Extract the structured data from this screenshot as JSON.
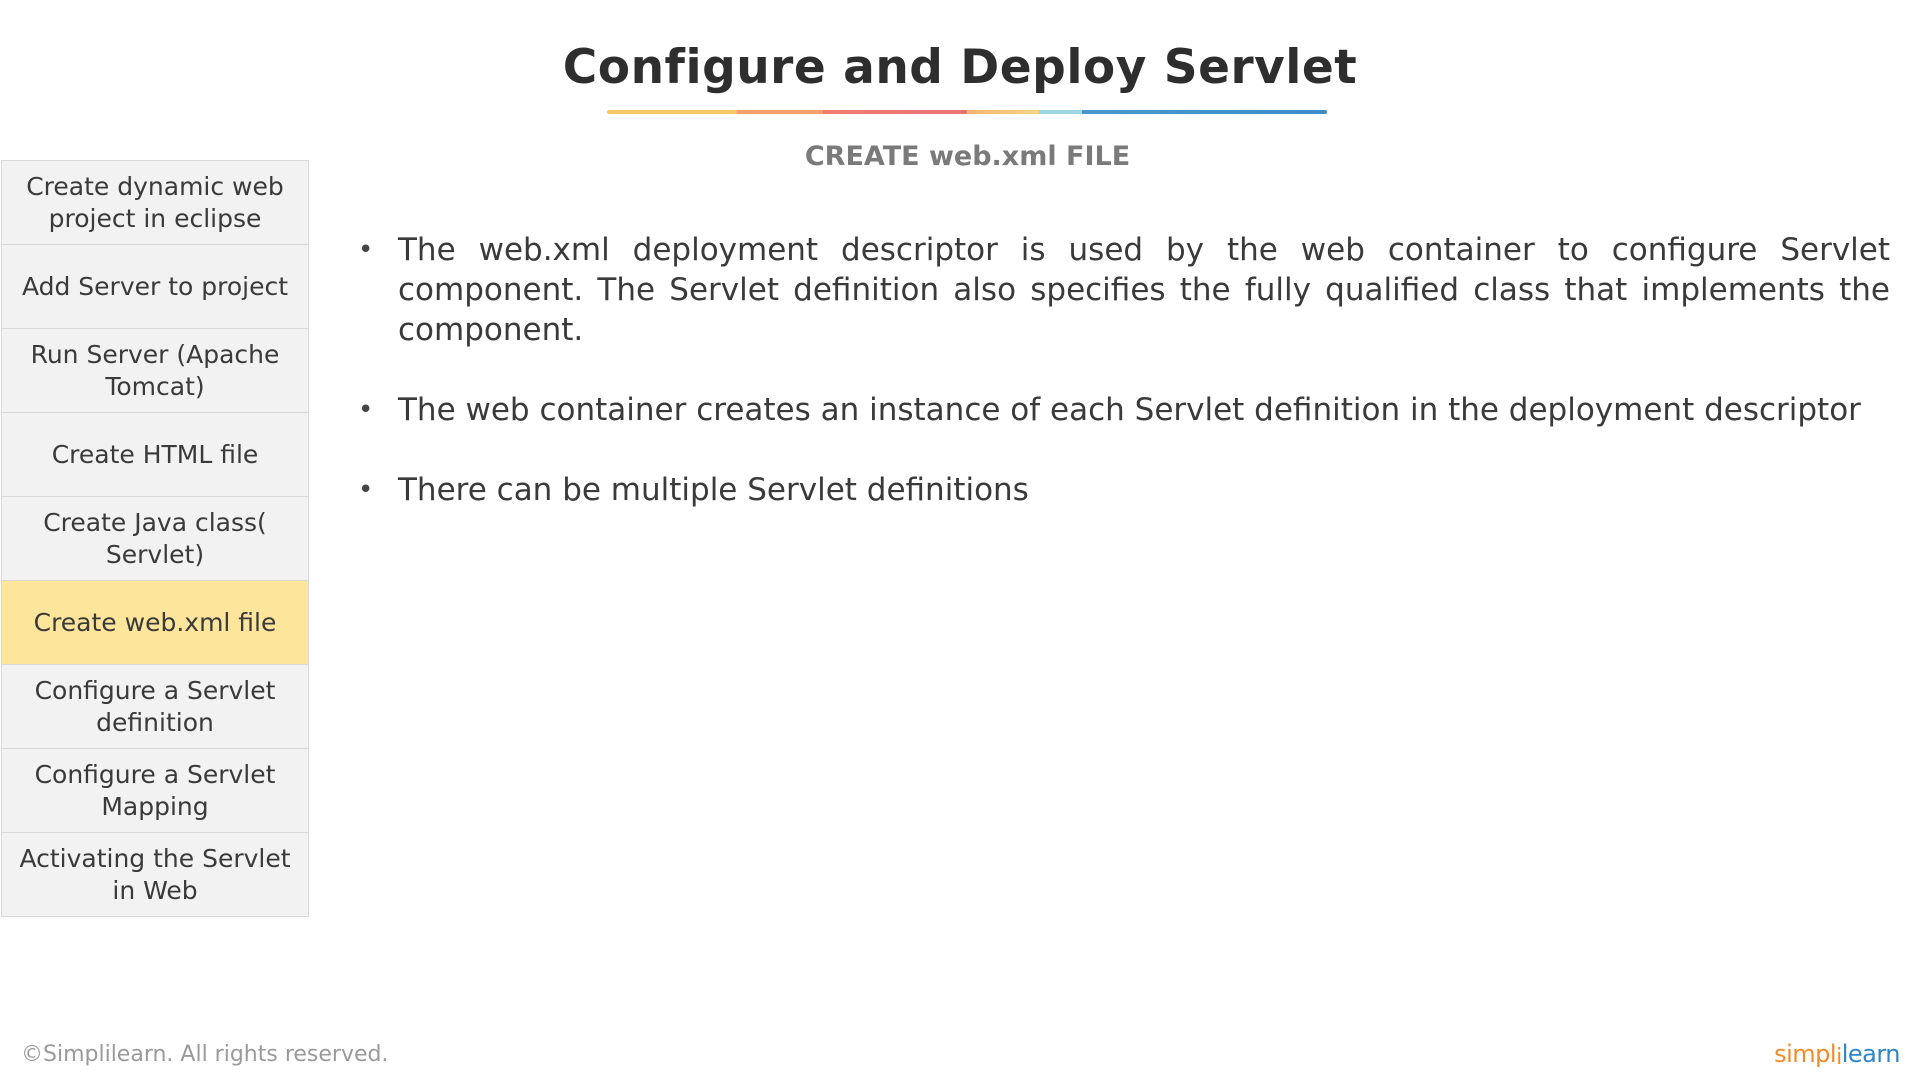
{
  "slide": {
    "title": "Configure and Deploy Servlet",
    "subtitle": "CREATE web.xml FILE"
  },
  "sidebar": {
    "items": [
      {
        "label": "Create dynamic web project in eclipse",
        "active": false
      },
      {
        "label": "Add Server to project",
        "active": false
      },
      {
        "label": "Run Server (Apache Tomcat)",
        "active": false
      },
      {
        "label": "Create HTML file",
        "active": false
      },
      {
        "label": "Create Java class( Servlet)",
        "active": false
      },
      {
        "label": "Create web.xml file",
        "active": true
      },
      {
        "label": "Configure a Servlet definition",
        "active": false
      },
      {
        "label": "Configure a Servlet Mapping",
        "active": false
      },
      {
        "label": "Activating the Servlet in Web",
        "active": false
      }
    ],
    "active_color": "#fde59b",
    "item_color": "#f2f2f2"
  },
  "content": {
    "bullet_symbol": "•",
    "bullets": [
      "The web.xml deployment descriptor is used by the web container to configure Servlet component. The Servlet definition also specifies the fully qualified class that implements the component.",
      "The web container creates an instance of each Servlet definition in the deployment descriptor",
      "There can be multiple Servlet definitions"
    ]
  },
  "footer": {
    "copyright": "©Simplilearn. All rights reserved.",
    "logo_part_a": "simpl",
    "logo_separator": "i",
    "logo_part_b": "learn"
  }
}
